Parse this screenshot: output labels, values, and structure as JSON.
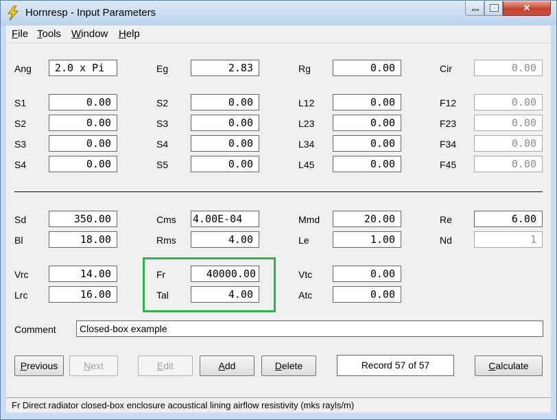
{
  "window": {
    "title": "Hornresp - Input Parameters"
  },
  "menu": [
    {
      "label": "File",
      "accel": "F"
    },
    {
      "label": "Tools",
      "accel": "T"
    },
    {
      "label": "Window",
      "accel": "W"
    },
    {
      "label": "Help",
      "accel": "H"
    }
  ],
  "fields": {
    "ang": {
      "label": "Ang",
      "value": "2.0 x Pi"
    },
    "eg": {
      "label": "Eg",
      "value": "2.83"
    },
    "rg": {
      "label": "Rg",
      "value": "0.00"
    },
    "cir": {
      "label": "Cir",
      "value": "0.00"
    },
    "col1": [
      {
        "label": "S1",
        "value": "0.00"
      },
      {
        "label": "S2",
        "value": "0.00"
      },
      {
        "label": "S3",
        "value": "0.00"
      },
      {
        "label": "S4",
        "value": "0.00"
      }
    ],
    "col2": [
      {
        "label": "S2",
        "value": "0.00"
      },
      {
        "label": "S3",
        "value": "0.00"
      },
      {
        "label": "S4",
        "value": "0.00"
      },
      {
        "label": "S5",
        "value": "0.00"
      }
    ],
    "col3": [
      {
        "label": "L12",
        "value": "0.00"
      },
      {
        "label": "L23",
        "value": "0.00"
      },
      {
        "label": "L34",
        "value": "0.00"
      },
      {
        "label": "L45",
        "value": "0.00"
      }
    ],
    "col4": [
      {
        "label": "F12",
        "value": "0.00"
      },
      {
        "label": "F23",
        "value": "0.00"
      },
      {
        "label": "F34",
        "value": "0.00"
      },
      {
        "label": "F45",
        "value": "0.00"
      }
    ],
    "sd": {
      "label": "Sd",
      "value": "350.00"
    },
    "bl": {
      "label": "Bl",
      "value": "18.00"
    },
    "cms": {
      "label": "Cms",
      "value": "4.00E-04"
    },
    "rms": {
      "label": "Rms",
      "value": "4.00"
    },
    "mmd": {
      "label": "Mmd",
      "value": "20.00"
    },
    "le": {
      "label": "Le",
      "value": "1.00"
    },
    "re": {
      "label": "Re",
      "value": "6.00"
    },
    "nd": {
      "label": "Nd",
      "value": "1"
    },
    "vrc": {
      "label": "Vrc",
      "value": "14.00"
    },
    "lrc": {
      "label": "Lrc",
      "value": "16.00"
    },
    "fr": {
      "label": "Fr",
      "value": "40000.00"
    },
    "tal": {
      "label": "Tal",
      "value": "4.00"
    },
    "vtc": {
      "label": "Vtc",
      "value": "0.00"
    },
    "atc": {
      "label": "Atc",
      "value": "0.00"
    }
  },
  "comment": {
    "label": "Comment",
    "value": "Closed-box example"
  },
  "buttons": {
    "previous": "Previous",
    "next": "Next",
    "edit": "Edit",
    "add": "Add",
    "delete": "Delete",
    "calculate": "Calculate"
  },
  "record": "Record 57 of 57",
  "status": "Fr  Direct radiator closed-box enclosure acoustical lining airflow resistivity  (mks rayls/m)",
  "colors": {
    "highlight": "#2db34a",
    "close_button": "#c7422e",
    "title_gradient": "#bcd3ec"
  }
}
